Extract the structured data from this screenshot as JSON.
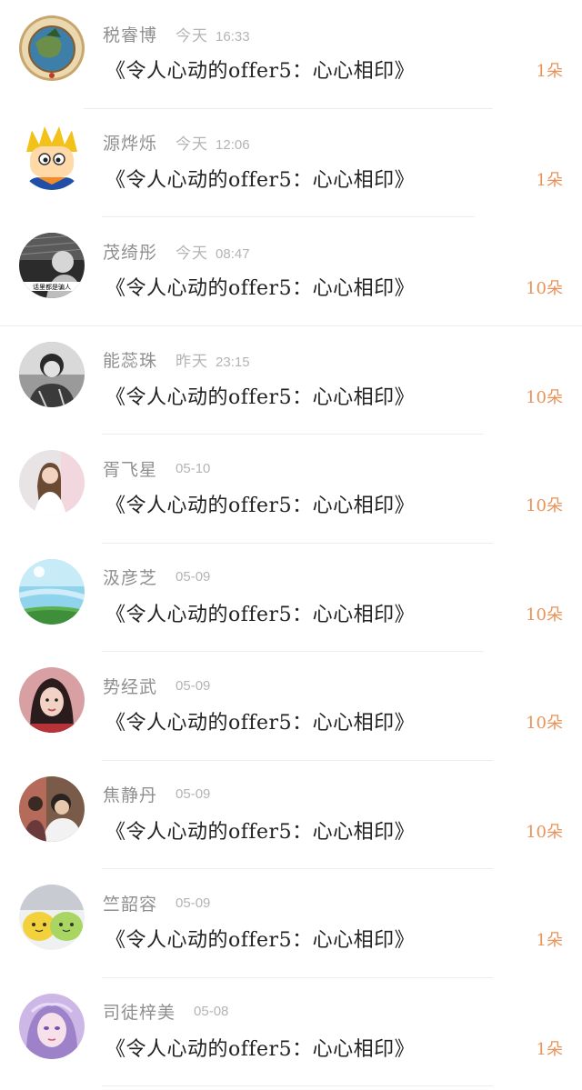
{
  "rows": [
    {
      "name": "税睿博",
      "day": "今天",
      "time": "16:33",
      "gift": "《令人心动的offer5：心心相印》",
      "count": "1朵",
      "avatar": "globe-emblem-avatar"
    },
    {
      "name": "源烨烁",
      "day": "今天",
      "time": "12:06",
      "gift": "《令人心动的offer5：心心相印》",
      "count": "1朵",
      "avatar": "cartoon-character-avatar"
    },
    {
      "name": "茂绮彤",
      "day": "今天",
      "time": "08:47",
      "gift": "《令人心动的offer5：心心相印》",
      "count": "10朵",
      "avatar": "bw-photo-avatar",
      "avatar_caption": "话里都是骗人"
    },
    {
      "name": "能蕊珠",
      "day": "昨天",
      "time": "23:15",
      "gift": "《令人心动的offer5：心心相印》",
      "count": "10朵",
      "avatar": "bw-portrait-avatar"
    },
    {
      "name": "胥飞星",
      "day": "",
      "time": "05-10",
      "gift": "《令人心动的offer5：心心相印》",
      "count": "10朵",
      "avatar": "girl-photo-avatar"
    },
    {
      "name": "汲彦芝",
      "day": "",
      "time": "05-09",
      "gift": "《令人心动的offer5：心心相印》",
      "count": "10朵",
      "avatar": "sky-landscape-avatar"
    },
    {
      "name": "势经武",
      "day": "",
      "time": "05-09",
      "gift": "《令人心动的offer5：心心相印》",
      "count": "10朵",
      "avatar": "woman-portrait-avatar"
    },
    {
      "name": "焦静丹",
      "day": "",
      "time": "05-09",
      "gift": "《令人心动的offer5：心心相印》",
      "count": "10朵",
      "avatar": "people-photo-avatar"
    },
    {
      "name": "竺韶容",
      "day": "",
      "time": "05-09",
      "gift": "《令人心动的offer5：心心相印》",
      "count": "1朵",
      "avatar": "cute-blobs-avatar"
    },
    {
      "name": "司徒梓美",
      "day": "",
      "time": "05-08",
      "gift": "《令人心动的offer5：心心相印》",
      "count": "1朵",
      "avatar": "anime-girl-avatar"
    }
  ]
}
